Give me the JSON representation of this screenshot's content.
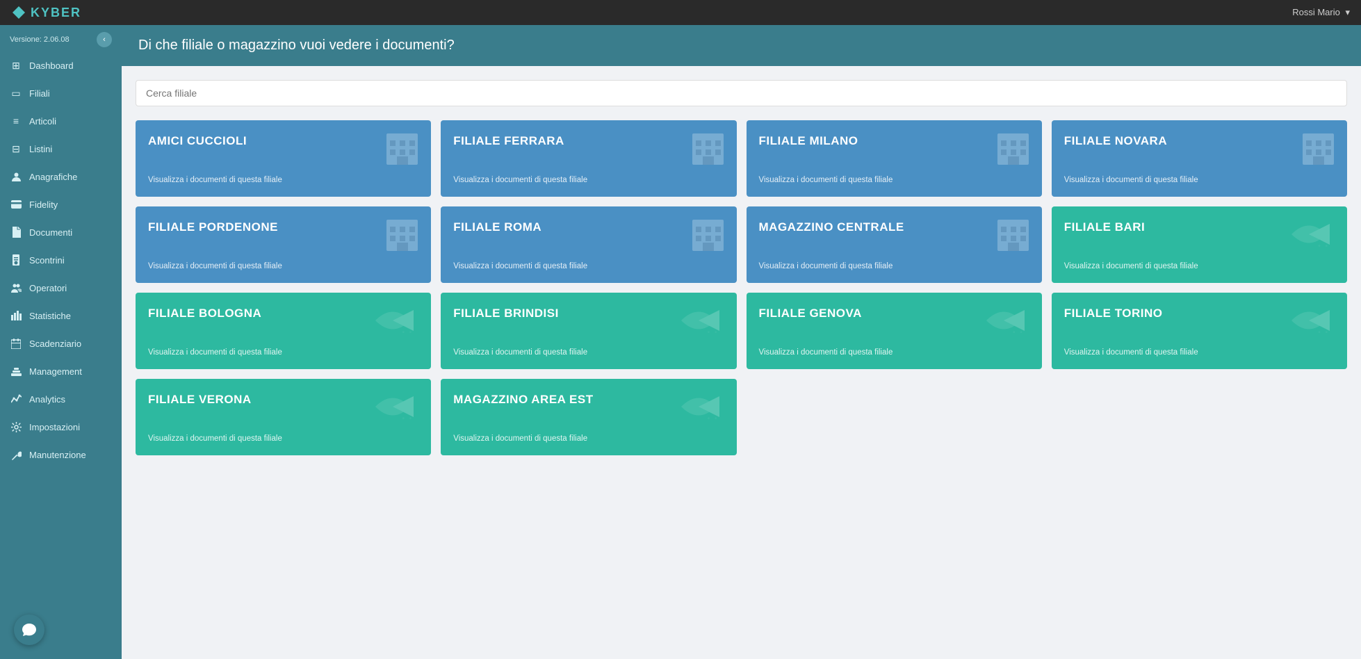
{
  "topbar": {
    "logo_text": "KYBER",
    "user": "Rossi Mario",
    "user_caret": "▾"
  },
  "sidebar": {
    "version_label": "Versione: 2.06.08",
    "collapse_icon": "‹",
    "items": [
      {
        "id": "dashboard",
        "label": "Dashboard",
        "icon": "⊞"
      },
      {
        "id": "filiali",
        "label": "Filiali",
        "icon": "▭"
      },
      {
        "id": "articoli",
        "label": "Articoli",
        "icon": "≡"
      },
      {
        "id": "listini",
        "label": "Listini",
        "icon": "⊟"
      },
      {
        "id": "anagrafiche",
        "label": "Anagrafiche",
        "icon": "👤"
      },
      {
        "id": "fidelity",
        "label": "Fidelity",
        "icon": "💳"
      },
      {
        "id": "documenti",
        "label": "Documenti",
        "icon": "📄"
      },
      {
        "id": "scontrini",
        "label": "Scontrini",
        "icon": "🔒"
      },
      {
        "id": "operatori",
        "label": "Operatori",
        "icon": "👤"
      },
      {
        "id": "statistiche",
        "label": "Statistiche",
        "icon": "📊"
      },
      {
        "id": "scadenziario",
        "label": "Scadenziario",
        "icon": "📅"
      },
      {
        "id": "management",
        "label": "Management",
        "icon": "💼"
      },
      {
        "id": "analytics",
        "label": "Analytics",
        "icon": "📈"
      },
      {
        "id": "impostazioni",
        "label": "Impostazioni",
        "icon": "⚙"
      },
      {
        "id": "manutenzione",
        "label": "Manutenzione",
        "icon": "🔧"
      }
    ],
    "chat_icon": "💬"
  },
  "content": {
    "header": "Di che filiale o magazzino vuoi vedere i documenti?",
    "search_placeholder": "Cerca filiale"
  },
  "cards": [
    {
      "id": "amici-cuccioli",
      "title": "AMICI CUCCIOLI",
      "subtitle": "Visualizza i documenti di questa filiale",
      "color": "blue",
      "icon_type": "building"
    },
    {
      "id": "filiale-ferrara",
      "title": "FILIALE FERRARA",
      "subtitle": "Visualizza i documenti di questa filiale",
      "color": "blue",
      "icon_type": "building"
    },
    {
      "id": "filiale-milano",
      "title": "FILIALE MILANO",
      "subtitle": "Visualizza i documenti di questa filiale",
      "color": "blue",
      "icon_type": "building"
    },
    {
      "id": "filiale-novara",
      "title": "FILIALE NOVARA",
      "subtitle": "Visualizza i documenti di questa filiale",
      "color": "blue",
      "icon_type": "building"
    },
    {
      "id": "filiale-pordenone",
      "title": "FILIALE PORDENONE",
      "subtitle": "Visualizza i documenti di questa filiale",
      "color": "blue",
      "icon_type": "building"
    },
    {
      "id": "filiale-roma",
      "title": "FILIALE ROMA",
      "subtitle": "Visualizza i documenti di questa filiale",
      "color": "blue",
      "icon_type": "building"
    },
    {
      "id": "magazzino-centrale",
      "title": "MAGAZZINO CENTRALE",
      "subtitle": "Visualizza i documenti di questa filiale",
      "color": "blue",
      "icon_type": "building"
    },
    {
      "id": "filiale-bari",
      "title": "FILIALE BARI",
      "subtitle": "Visualizza i documenti di questa filiale",
      "color": "teal",
      "icon_type": "arrow"
    },
    {
      "id": "filiale-bologna",
      "title": "FILIALE BOLOGNA",
      "subtitle": "Visualizza i documenti di questa filiale",
      "color": "teal",
      "icon_type": "arrow"
    },
    {
      "id": "filiale-brindisi",
      "title": "FILIALE BRINDISI",
      "subtitle": "Visualizza i documenti di questa filiale",
      "color": "teal",
      "icon_type": "arrow"
    },
    {
      "id": "filiale-genova",
      "title": "FILIALE GENOVA",
      "subtitle": "Visualizza i documenti di questa filiale",
      "color": "teal",
      "icon_type": "arrow"
    },
    {
      "id": "filiale-torino",
      "title": "FILIALE TORINO",
      "subtitle": "Visualizza i documenti di questa filiale",
      "color": "teal",
      "icon_type": "arrow"
    },
    {
      "id": "filiale-verona",
      "title": "FILIALE VERONA",
      "subtitle": "Visualizza i documenti di questa filiale",
      "color": "teal",
      "icon_type": "arrow"
    },
    {
      "id": "magazzino-area-est",
      "title": "MAGAZZINO AREA EST",
      "subtitle": "Visualizza i documenti di questa filiale",
      "color": "teal",
      "icon_type": "arrow"
    }
  ],
  "colors": {
    "blue_card": "#4a90c4",
    "teal_card": "#2db9a0",
    "sidebar_bg": "#3a7d8c",
    "topbar_bg": "#2a2a2a"
  }
}
